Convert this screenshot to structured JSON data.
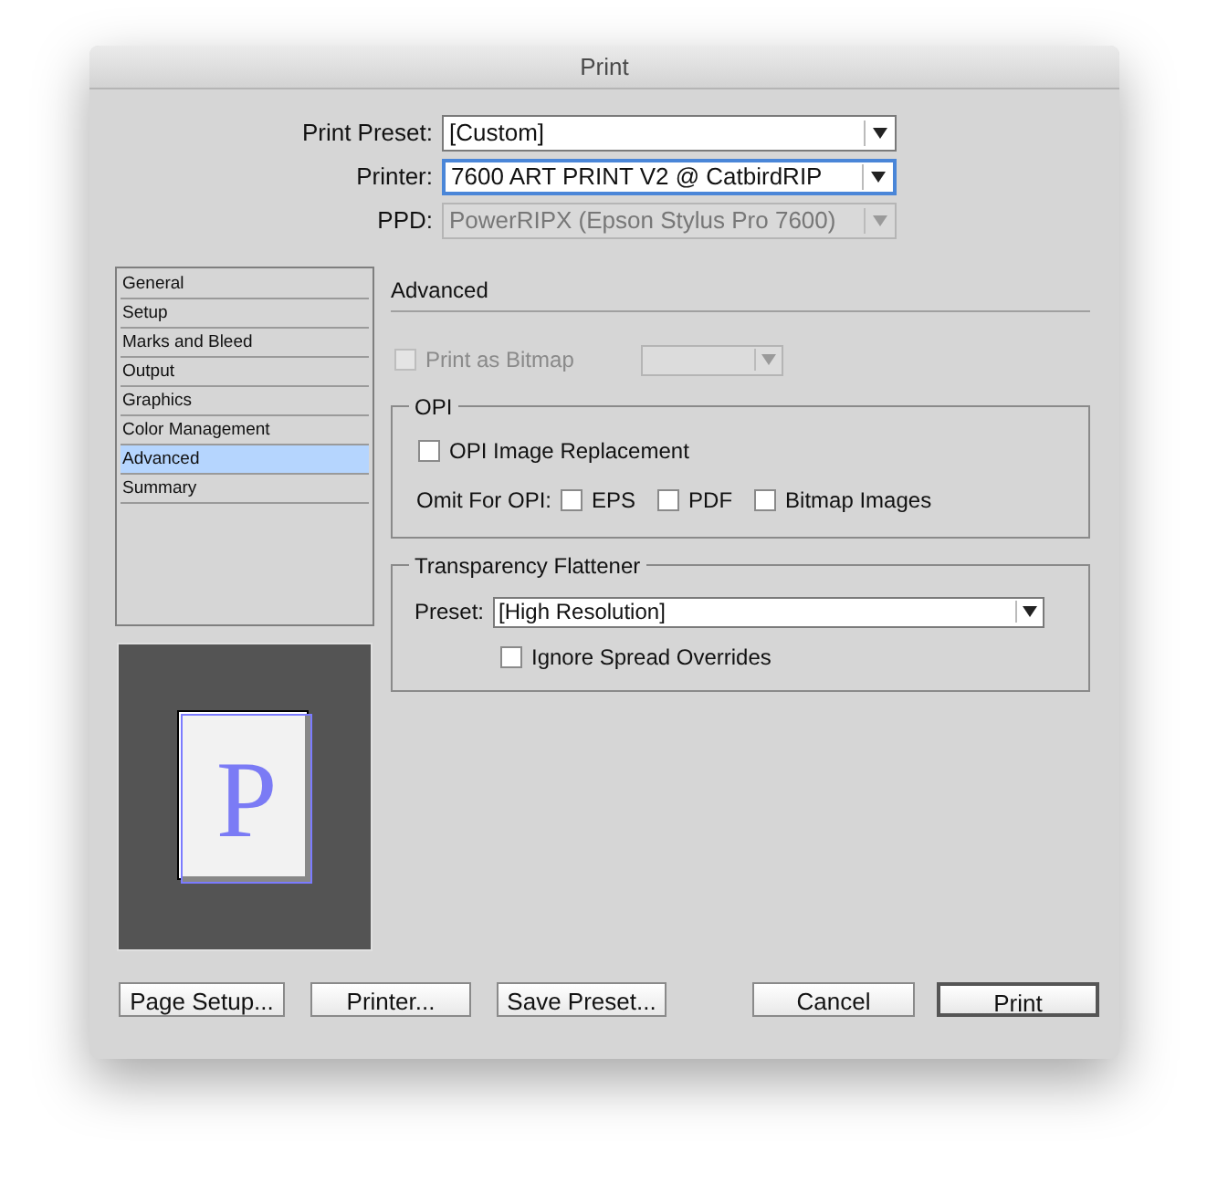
{
  "window": {
    "title": "Print"
  },
  "top_fields": [
    {
      "label": "Print Preset:",
      "value": "[Custom]",
      "focused": false,
      "disabled": false
    },
    {
      "label": "Printer:",
      "value": "7600 ART PRINT V2 @ CatbirdRIP",
      "focused": true,
      "disabled": false
    },
    {
      "label": "PPD:",
      "value": "PowerRIPX (Epson Stylus Pro 7600)",
      "focused": false,
      "disabled": true
    }
  ],
  "sidebar": {
    "items": [
      {
        "label": "General",
        "selected": false
      },
      {
        "label": "Setup",
        "selected": false
      },
      {
        "label": "Marks and Bleed",
        "selected": false
      },
      {
        "label": "Output",
        "selected": false
      },
      {
        "label": "Graphics",
        "selected": false
      },
      {
        "label": "Color Management",
        "selected": false
      },
      {
        "label": "Advanced",
        "selected": true
      },
      {
        "label": "Summary",
        "selected": false
      }
    ]
  },
  "preview": {
    "letter": "P"
  },
  "panel": {
    "heading": "Advanced",
    "print_as_bitmap": {
      "label": "Print as Bitmap",
      "checked": false,
      "disabled": true
    },
    "opi": {
      "title": "OPI",
      "image_replacement": {
        "label": "OPI Image Replacement",
        "checked": false
      },
      "omit_label": "Omit For OPI:",
      "omit_options": [
        {
          "label": "EPS",
          "checked": false
        },
        {
          "label": "PDF",
          "checked": false
        },
        {
          "label": "Bitmap Images",
          "checked": false
        }
      ]
    },
    "flattener": {
      "title": "Transparency Flattener",
      "preset_label": "Preset:",
      "preset_value": "[High Resolution]",
      "ignore_overrides": {
        "label": "Ignore Spread Overrides",
        "checked": false
      }
    }
  },
  "left_buttons": [
    {
      "label": "Page Setup...",
      "default": false
    },
    {
      "label": "Printer...",
      "default": false
    },
    {
      "label": "Save Preset...",
      "default": false
    }
  ],
  "right_buttons": [
    {
      "label": "Cancel",
      "default": false
    },
    {
      "label": "Print",
      "default": true
    }
  ]
}
